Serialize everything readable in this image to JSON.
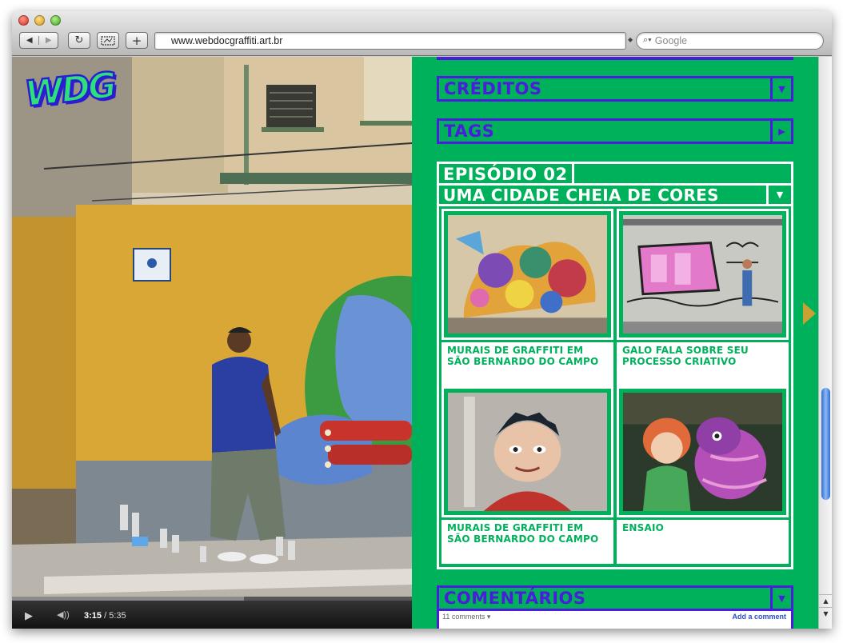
{
  "browser": {
    "url": "www.webdocgraffiti.art.br",
    "search_placeholder": "Google",
    "back_icon": "◀",
    "forward_icon": "▶",
    "reload_icon": "↻",
    "add_icon": "+"
  },
  "video": {
    "logo_text": "WDG",
    "current_time": "3:15",
    "duration": "/ 5:35",
    "progress": 0.58
  },
  "sections": {
    "creditos": "CRÉDITOS",
    "tags": "TAGS",
    "comentarios": "COMENTÁRIOS"
  },
  "episode": {
    "number_title": "EPISÓDIO 02",
    "subtitle": "UMA CIDADE CHEIA DE CORES",
    "videos": [
      {
        "caption": "MURAIS DE GRAFFITI EM SÃO BERNARDO DO CAMPO"
      },
      {
        "caption": "GALO FALA SOBRE SEU PROCESSO CRIATIVO"
      },
      {
        "caption": "MURAIS DE GRAFFITI EM SÃO BERNARDO DO CAMPO"
      },
      {
        "caption": "ENSAIO"
      }
    ]
  },
  "comments": {
    "count": "11 comments ▾",
    "add": "Add a comment"
  },
  "colors": {
    "panel_green": "#00b15b",
    "accent_purple": "#4a1cdc"
  }
}
